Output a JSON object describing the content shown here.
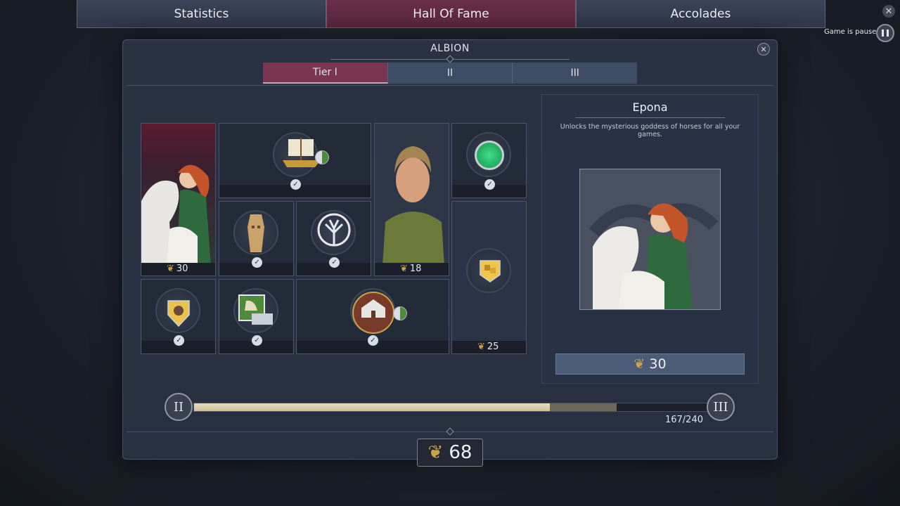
{
  "top_tabs": [
    "Statistics",
    "Hall Of Fame",
    "Accolades"
  ],
  "game_status": "Game is paused.",
  "panel": {
    "title": "ALBION",
    "tiers": [
      "Tier I",
      "II",
      "III"
    ]
  },
  "cards": {
    "epona_cost": "30",
    "portrait_cost": "18",
    "crates_cost": "25"
  },
  "detail": {
    "title": "Epona",
    "description": "Unlocks the mysterious goddess of horses for all your games.",
    "cost": "30"
  },
  "progress": {
    "start_label": "II",
    "end_label": "III",
    "current": 167,
    "max": 240,
    "count_text": "167/240",
    "fill_fraction": 0.69,
    "preview_fraction": 0.82
  },
  "total_points": "68",
  "colors": {
    "active_tab": "#5a2740",
    "panel": "#273040",
    "progress_fill": "#e9dcc0",
    "laurel": "#c9a24a"
  },
  "icons": [
    "close-icon",
    "pause-icon",
    "laurel-icon",
    "check-icon",
    "ship-icon",
    "green-orb-icon",
    "idol-icon",
    "tree-of-life-icon",
    "shield-portrait-icon",
    "bell-icon",
    "temple-icon",
    "crates-icon"
  ]
}
